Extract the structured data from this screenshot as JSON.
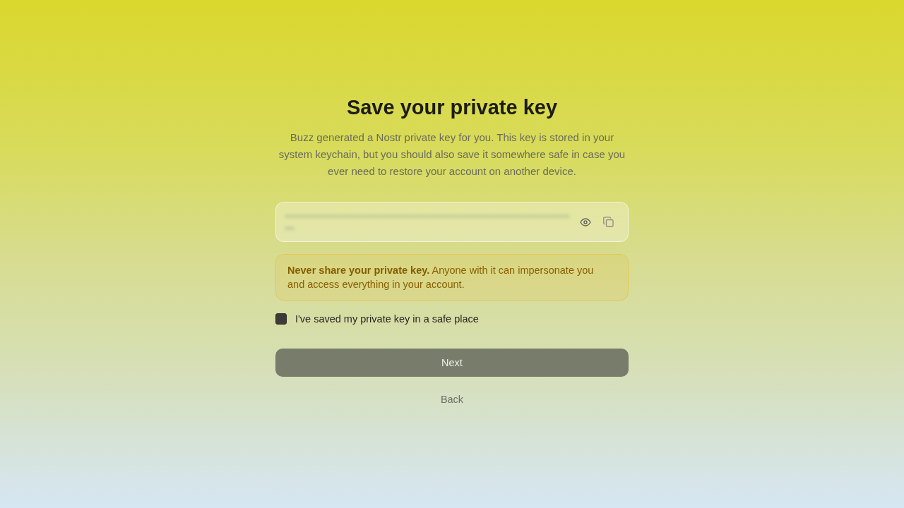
{
  "title": "Save your private key",
  "description": "Buzz generated a Nostr private key for you. This key is stored in your system keychain, but you should also save it somewhere safe in case you ever need to restore your account on another device.",
  "warning": "**Never share your private key.** Anyone with it can impersonate you and access everything in your account.",
  "checkbox": {
    "label": "I've saved my private key in a safe place",
    "checked": false
  },
  "next_button": {
    "label": "Next",
    "disabled": true
  },
  "back_link": "Back"
}
